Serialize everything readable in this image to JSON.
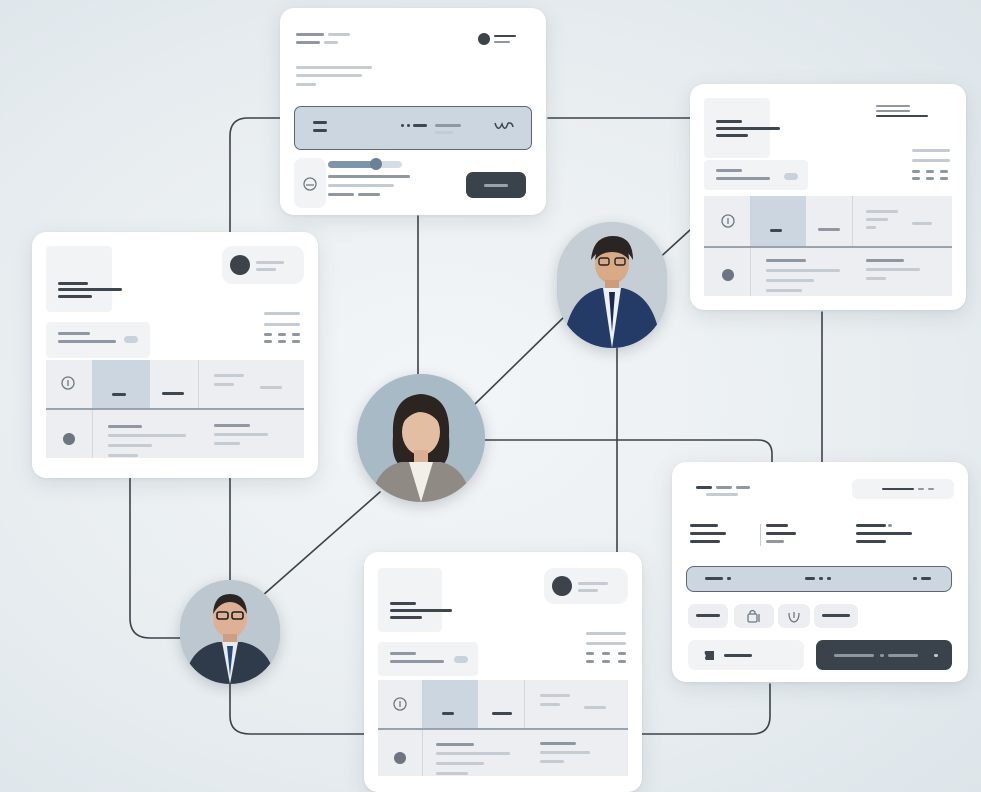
{
  "scene": {
    "description_free": true,
    "colors": {
      "background": "#e9eef1",
      "card": "#ffffff",
      "accent_blue": "#cbd6e0",
      "dark_button": "#3a424b",
      "connector": "#3c434a"
    }
  },
  "cards": {
    "payment": {
      "icons": [
        "payment-card-icon",
        "account-icon"
      ],
      "button_level": 0.75
    },
    "profile_left": {
      "icons": [
        "info-icon",
        "record-dot-icon"
      ]
    },
    "profile_right": {
      "icons": [
        "info-icon",
        "record-dot-icon"
      ]
    },
    "profile_bottom": {
      "icons": [
        "info-icon",
        "record-dot-icon"
      ]
    },
    "transaction": {
      "icons": [
        "lock-icon",
        "shield-icon",
        "wallet-icon"
      ]
    }
  },
  "people": [
    {
      "name": "person-avatar-woman-center"
    },
    {
      "name": "person-avatar-man-right"
    },
    {
      "name": "person-avatar-man-left"
    }
  ]
}
